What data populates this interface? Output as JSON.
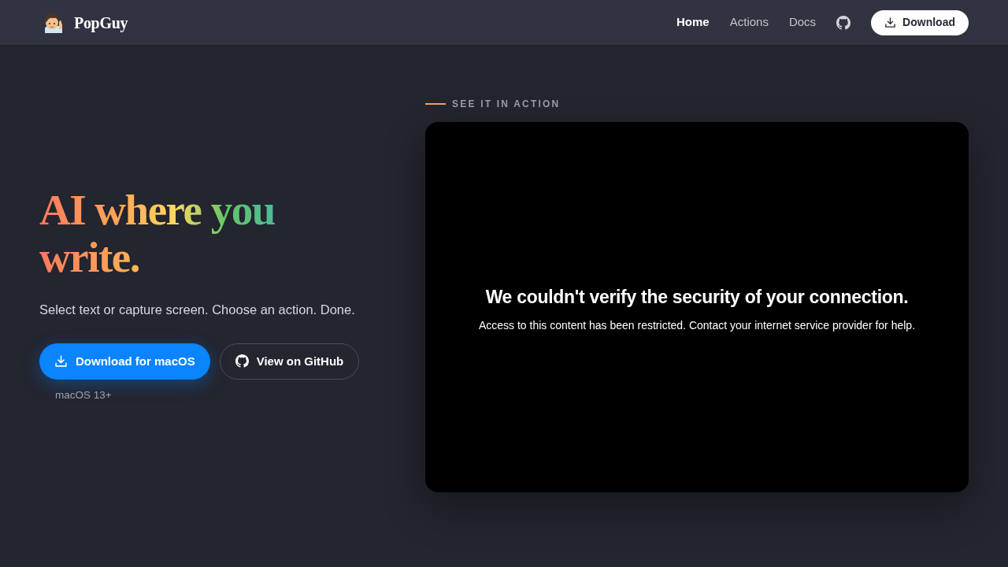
{
  "nav": {
    "brand": "PopGuy",
    "links": [
      {
        "label": "Home",
        "selected": true
      },
      {
        "label": "Actions",
        "selected": false
      },
      {
        "label": "Docs",
        "selected": false
      }
    ],
    "download": "Download"
  },
  "hero": {
    "headline": "AI where you write.",
    "subtitle": "Select text or capture screen. Choose an action. Done.",
    "buttons": [
      {
        "label": "Download for macOS",
        "kind": "primary"
      },
      {
        "label": "View on GitHub",
        "kind": "secondary"
      }
    ],
    "note": "macOS 13+"
  },
  "demo": {
    "label": "SEE IT IN ACTION",
    "title": "We couldn't verify the security of your connection.",
    "message": "Access to this content has been restricted. Contact your internet service provider for help."
  }
}
